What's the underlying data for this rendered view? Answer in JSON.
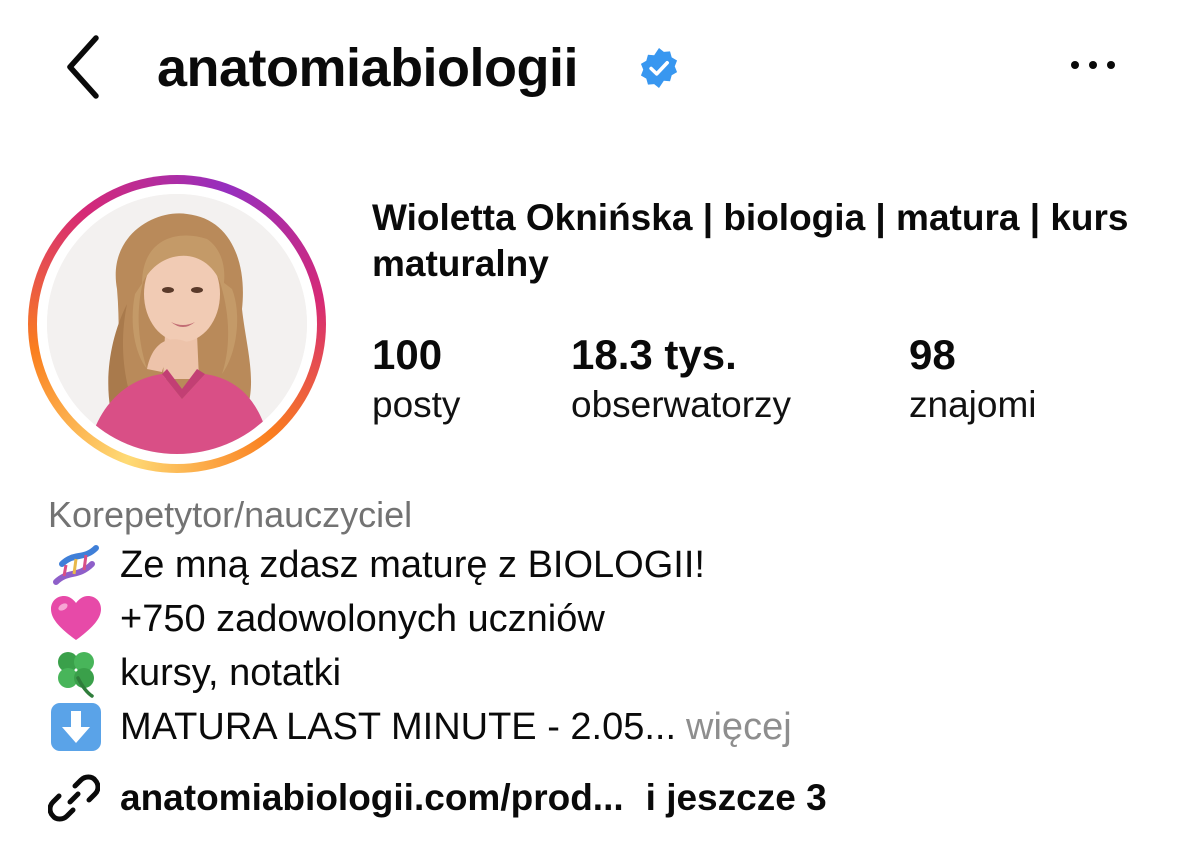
{
  "header": {
    "username": "anatomiabiologii",
    "back_icon": "chevron-left-icon",
    "verified_icon": "verified-badge-icon",
    "more_icon": "more-horizontal-icon"
  },
  "profile": {
    "display_name": "Wioletta Oknińska | biologia | matura | kurs maturalny",
    "avatar_ring_colors": [
      "#feda75",
      "#fa7e1e",
      "#d62976",
      "#962fbf"
    ]
  },
  "stats": [
    {
      "value": "100",
      "label": "posty"
    },
    {
      "value": "18.3 tys.",
      "label": "obserwatorzy"
    },
    {
      "value": "98",
      "label": "znajomi"
    }
  ],
  "bio": {
    "category": "Korepetytor/nauczyciel",
    "lines": [
      {
        "emoji": "dna-icon",
        "text": "Ze mną zdasz maturę z BIOLOGII!"
      },
      {
        "emoji": "pink-heart-icon",
        "text": "+750 zadowolonych uczniów"
      },
      {
        "emoji": "four-leaf-clover-icon",
        "text": "kursy, notatki"
      },
      {
        "emoji": "down-arrow-icon",
        "text": "MATURA LAST MINUTE - 2.05...",
        "more": "więcej"
      }
    ]
  },
  "links": {
    "icon": "link-icon",
    "url": "anatomiabiologii.com/prod...",
    "extra": "i jeszcze 3"
  },
  "colors": {
    "verified_blue": "#3897f0",
    "secondary_text": "#737373",
    "more_text": "#8e8e8e"
  }
}
